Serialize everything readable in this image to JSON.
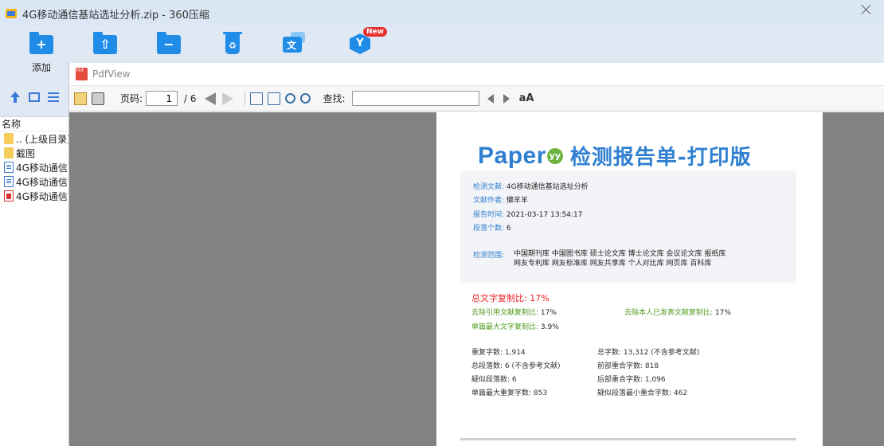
{
  "window": {
    "title": "4G移动通信基站选址分析.zip - 360压缩"
  },
  "toolbar": {
    "add_label": "添加",
    "new_badge": "New"
  },
  "file_list": {
    "column_name": "名称",
    "items": [
      {
        "name": ".. (上级目录)",
        "type": "folder"
      },
      {
        "name": "截图",
        "type": "folder"
      },
      {
        "name": "4G移动通信",
        "type": "doc"
      },
      {
        "name": "4G移动通信",
        "type": "doc"
      },
      {
        "name": "4G移动通信",
        "type": "pdf"
      }
    ]
  },
  "pdfview": {
    "title": "PdfView",
    "page_label": "页码:",
    "current_page": "1",
    "total_pages": "/ 6",
    "find_label": "查找:",
    "find_value": ""
  },
  "report": {
    "brand": "Paper",
    "brand_badge": "yy",
    "title": "检测报告单-打印版",
    "info": {
      "doc_key": "检测文献:",
      "doc_val": "4G移动通信基站选址分析",
      "author_key": "文献作者:",
      "author_val": "懒羊羊",
      "time_key": "报告时间:",
      "time_val": "2021-03-17 13:54:17",
      "para_key": "段落个数:",
      "para_val": "6",
      "scope_key": "检测范围:",
      "scope_line1": "中国期刊库 中国图书库 硕士论文库 博士论文库 会议论文库 报纸库",
      "scope_line2": "网友专利库 网友标准库 网友共享库 个人对比库 网页库 百科库"
    },
    "similarity": {
      "total": "总文字复制比: 17%",
      "excl_ref_key": "去除引用文献复制比:",
      "excl_ref_val": "17%",
      "excl_self_key": "去除本人已发表文献复制比:",
      "excl_self_val": "17%",
      "max_single_key": "单篇最大文字复制比:",
      "max_single_val": "3.9%"
    },
    "stats": {
      "dup_chars": "重复字数: 1,914",
      "total_chars": "总字数: 13,312 (不含参考文献)",
      "total_paras": "总段落数: 6 (不含参考文献)",
      "front_overlap": "前部重合字数: 818",
      "susp_paras": "疑似段落数: 6",
      "back_overlap": "后部重合字数: 1,096",
      "max_dup_single": "单篇最大重复字数: 853",
      "min_susp_overlap": "疑似段落最小重合字数: 462"
    }
  }
}
